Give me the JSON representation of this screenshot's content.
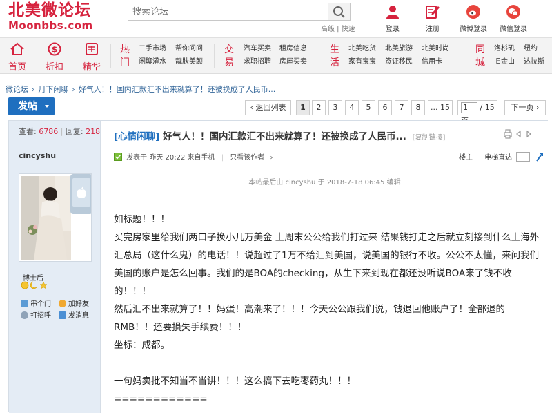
{
  "header": {
    "logo_cn": "北美微论坛",
    "logo_en": "Moonbbs.com",
    "search_placeholder": "搜索论坛",
    "search_links": "高级 | 快速",
    "login": "登录",
    "register": "注册",
    "weibo_login": "微博登录",
    "wechat_login": "微信登录"
  },
  "nav": {
    "home": "首页",
    "discount": "折扣",
    "featured": "精华",
    "hot": {
      "label": "热门",
      "links": [
        "二手市场",
        "帮你问问",
        "闲聊灌水",
        "靓肤美颜"
      ]
    },
    "trade": {
      "label": "交易",
      "links": [
        "汽车买卖",
        "租房信息",
        "求职招聘",
        "房屋买卖"
      ]
    },
    "life": {
      "label": "生活",
      "links": [
        "北美吃货",
        "北美旅游",
        "北美时尚",
        "家有宝宝",
        "签证移民",
        "信用卡"
      ]
    },
    "city": {
      "label": "同城",
      "links": [
        "洛杉矶",
        "纽约",
        "旧金山",
        "达拉斯"
      ]
    }
  },
  "breadcrumb": [
    "微论坛",
    "月下闲聊",
    "好气人！！国内汇款汇不出来就算了！还被换成了人民币..."
  ],
  "toolbar": {
    "post_button": "发帖",
    "back_list": "返回列表",
    "pages": [
      "1",
      "2",
      "3",
      "4",
      "5",
      "6",
      "7",
      "8",
      "... 15"
    ],
    "current_page": "1",
    "total_pages": "/ 15 页",
    "next": "下一页"
  },
  "sidebar": {
    "views_label": "查看:",
    "views": "6786",
    "replies_label": "回复:",
    "replies": "218",
    "username": "cincyshu",
    "rank": "博士后",
    "actions": [
      "串个门",
      "加好友",
      "打招呼",
      "发消息"
    ]
  },
  "post": {
    "category": "[心情闲聊]",
    "title": "好气人！！国内汇款汇不出来就算了！还被换成了人民币...",
    "copy_link": "[复制链接]",
    "meta": "发表于 昨天 20:22 来自手机",
    "only_author": "只看该作者",
    "floor": "楼主",
    "jump_floor": "电梯直达",
    "edit_note": "本帖最后由 cincyshu 于 2018-7-18 06:45 编辑",
    "lines": [
      "如标题！！！",
      "买完房家里给我们两口子换小几万美金 上周末公公给我们打过来 结果钱打走之后就立刻接到什么上海外",
      "汇总局（这什么鬼）的电话！！说超过了1万不给汇到美国，说美国的银行不收。公公不太懂，来问我们",
      "美国的账户是怎么回事。我们的是BOA的checking，从生下来到现在都还没听说BOA来了钱不收",
      "的！！！",
      "然后汇不出来就算了！！妈蛋！高潮来了！！！今天公公跟我们说，钱退回他账户了！全部退的",
      "RMB！！还要损失手续费！！！",
      "坐标：成都。",
      "",
      "一句妈卖批不知当不当讲！！！这么搞下去吃枣药丸！！！",
      "============"
    ]
  }
}
